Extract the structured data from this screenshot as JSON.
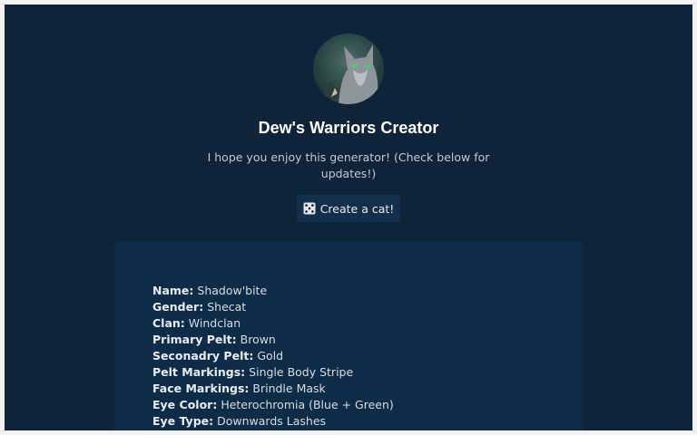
{
  "header": {
    "title": "Dew's Warriors Creator",
    "subtitle": "I hope you enjoy this generator! (Check below for updates!)",
    "avatar_icon": "cat-avatar-icon"
  },
  "actions": {
    "create_label": "Create a cat!",
    "create_icon": "dice-icon"
  },
  "cat": {
    "fields": [
      {
        "label": "Name:",
        "value": "Shadow'bite"
      },
      {
        "label": "Gender:",
        "value": "Shecat"
      },
      {
        "label": "Clan:",
        "value": "Windclan"
      },
      {
        "label": "Primary Pelt:",
        "value": "Brown"
      },
      {
        "label": "Seconadry Pelt:",
        "value": "Gold"
      },
      {
        "label": "Pelt Markings:",
        "value": "Single Body Stripe"
      },
      {
        "label": "Face Markings:",
        "value": "Brindle Mask"
      },
      {
        "label": "Eye Color:",
        "value": "Heterochromia (Blue + Green)"
      },
      {
        "label": "Eye Type:",
        "value": "Downwards Lashes"
      }
    ]
  },
  "colors": {
    "page_bg": "#0f2339",
    "card_bg": "#0e2b47",
    "button_bg": "#142f4c"
  }
}
